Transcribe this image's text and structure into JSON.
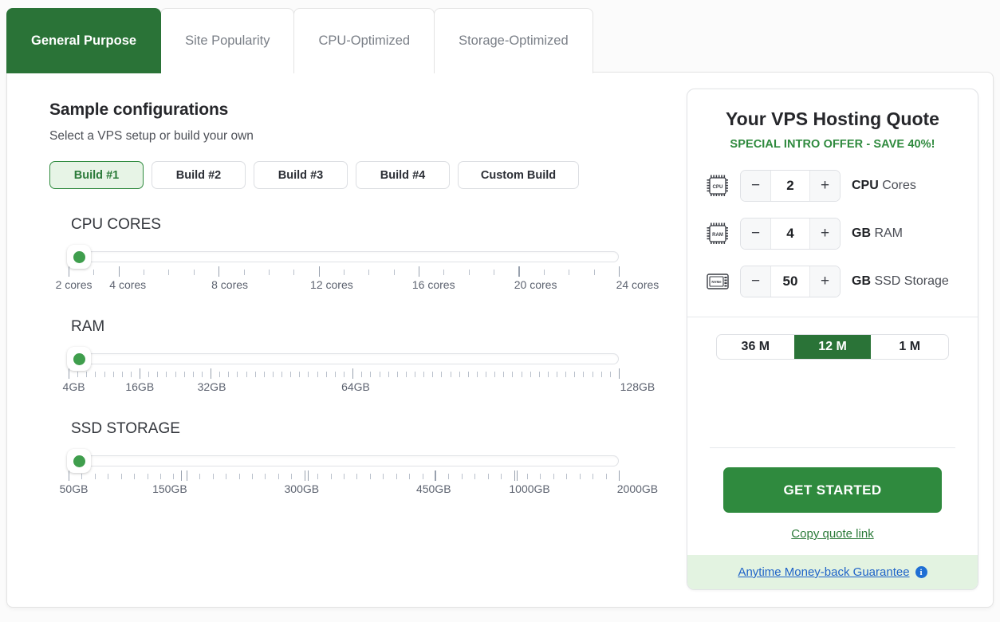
{
  "tabs": [
    {
      "label": "General Purpose",
      "active": true
    },
    {
      "label": "Site Popularity",
      "active": false
    },
    {
      "label": "CPU-Optimized",
      "active": false
    },
    {
      "label": "Storage-Optimized",
      "active": false
    }
  ],
  "main": {
    "section_title": "Sample configurations",
    "section_subtitle": "Select a VPS setup or build your own",
    "builds": [
      {
        "label": "Build #1",
        "active": true
      },
      {
        "label": "Build #2",
        "active": false
      },
      {
        "label": "Build #3",
        "active": false
      },
      {
        "label": "Build #4",
        "active": false
      },
      {
        "label": "Custom Build",
        "active": false
      }
    ]
  },
  "sliders": [
    {
      "name": "cpu-cores",
      "label": "CPU CORES",
      "value_pct": 0,
      "scale_labels": [
        "2 cores",
        "4 cores",
        "8 cores",
        "12 cores",
        "16 cores",
        "20 cores",
        "24 cores"
      ],
      "scale_pos": [
        3,
        12,
        29,
        46,
        63,
        80,
        97
      ],
      "major_ticks": [
        0,
        9.09,
        27.27,
        45.45,
        63.63,
        81.81,
        100
      ],
      "minor_count": 22
    },
    {
      "name": "ram",
      "label": "RAM",
      "value_pct": 0,
      "scale_labels": [
        "4GB",
        "16GB",
        "32GB",
        "64GB",
        "128GB"
      ],
      "scale_pos": [
        3,
        14,
        26,
        50,
        97
      ],
      "major_ticks": [
        0,
        12.9,
        25.8,
        51.6,
        100
      ],
      "minor_count": 62
    },
    {
      "name": "ssd-storage",
      "label": "SSD STORAGE",
      "value_pct": 0,
      "scale_labels": [
        "50GB",
        "150GB",
        "300GB",
        "450GB",
        "1000GB",
        "2000GB"
      ],
      "scale_pos": [
        3,
        19,
        41,
        63,
        79,
        97
      ],
      "major_ticks": [
        0,
        20.5,
        43.5,
        66.5,
        81.5,
        100
      ],
      "minor_count": 42
    }
  ],
  "quote": {
    "title": "Your VPS Hosting Quote",
    "offer": "SPECIAL INTRO OFFER - SAVE 40%!",
    "specs": [
      {
        "icon": "cpu-chip-icon",
        "icon_text": "CPU",
        "minus": "−",
        "plus": "+",
        "value": "2",
        "unit": "CPU",
        "unit_rest": " Cores"
      },
      {
        "icon": "ram-chip-icon",
        "icon_text": "RAM",
        "minus": "−",
        "plus": "+",
        "value": "4",
        "unit": "GB",
        "unit_rest": " RAM"
      },
      {
        "icon": "nvme-drive-icon",
        "icon_text": "NVMe",
        "minus": "−",
        "plus": "+",
        "value": "50",
        "unit": "GB",
        "unit_rest": " SSD Storage"
      }
    ],
    "terms": [
      {
        "label": "36 M",
        "active": false
      },
      {
        "label": "12 M",
        "active": true
      },
      {
        "label": "1 M",
        "active": false
      }
    ],
    "cta_label": "GET STARTED",
    "copy_link_label": "Copy quote link",
    "guarantee_label": "Anytime Money-back Guarantee",
    "info_glyph": "i"
  },
  "colors": {
    "brand_green": "#2a7337",
    "cta_green": "#2f8a3e",
    "thumb_green": "#3f9e4d",
    "link_blue": "#1f63c8",
    "banner_green": "#e3f3e1"
  }
}
